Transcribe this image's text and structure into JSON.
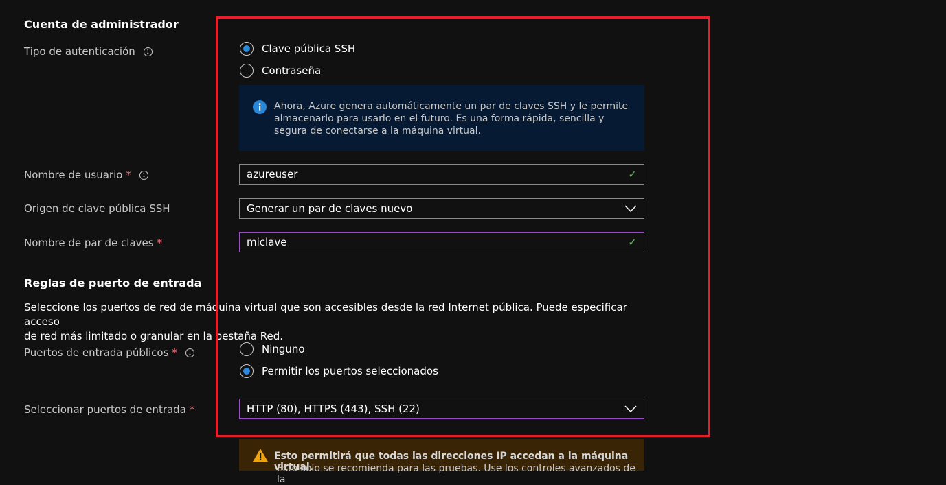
{
  "admin": {
    "section_title": "Cuenta de administrador",
    "auth_type_label": "Tipo de autenticación",
    "auth_options": [
      {
        "label": "Clave pública SSH",
        "selected": true
      },
      {
        "label": "Contraseña",
        "selected": false
      }
    ],
    "info_text": "Ahora, Azure genera automáticamente un par de claves SSH y le permite almacenarlo para usarlo en el futuro. Es una forma rápida, sencilla y segura de conectarse a la máquina virtual.",
    "username_label": "Nombre de usuario",
    "username_value": "azureuser",
    "ssh_source_label": "Origen de clave pública SSH",
    "ssh_source_value": "Generar un par de claves nuevo",
    "keypair_label": "Nombre de par de claves",
    "keypair_value": "miclave"
  },
  "ports": {
    "section_title": "Reglas de puerto de entrada",
    "description_line1": "Seleccione los puertos de red de máquina virtual que son accesibles desde la red Internet pública. Puede especificar acceso",
    "description_line2": "de red más limitado o granular en la pestaña Red.",
    "public_ports_label": "Puertos de entrada públicos",
    "public_ports_options": [
      {
        "label": "Ninguno",
        "selected": false
      },
      {
        "label": "Permitir los puertos seleccionados",
        "selected": true
      }
    ],
    "select_ports_label": "Seleccionar puertos de entrada",
    "select_ports_value": "HTTP (80), HTTPS (443), SSH (22)",
    "warning_title": "Esto permitirá que todas las direcciones IP accedan a la máquina virtual.",
    "warning_sub": "Esto solo se recomienda para las pruebas. Use los controles avanzados de la"
  },
  "symbols": {
    "required_mark": "*",
    "info_glyph": "i",
    "check_glyph": "✓",
    "warning_glyph": "!"
  },
  "icons": [
    "info-circle-icon",
    "checkmark-icon",
    "chevron-down-icon",
    "warning-triangle-icon"
  ],
  "colors": {
    "background": "#111111",
    "accent": "#2b88d8",
    "highlight_frame": "#e5202c",
    "focus_border": "#9b4fc7",
    "valid_check": "#54b054",
    "info_bg": "#061a33",
    "warning_bg": "#3a2406",
    "required": "#f1707b"
  }
}
